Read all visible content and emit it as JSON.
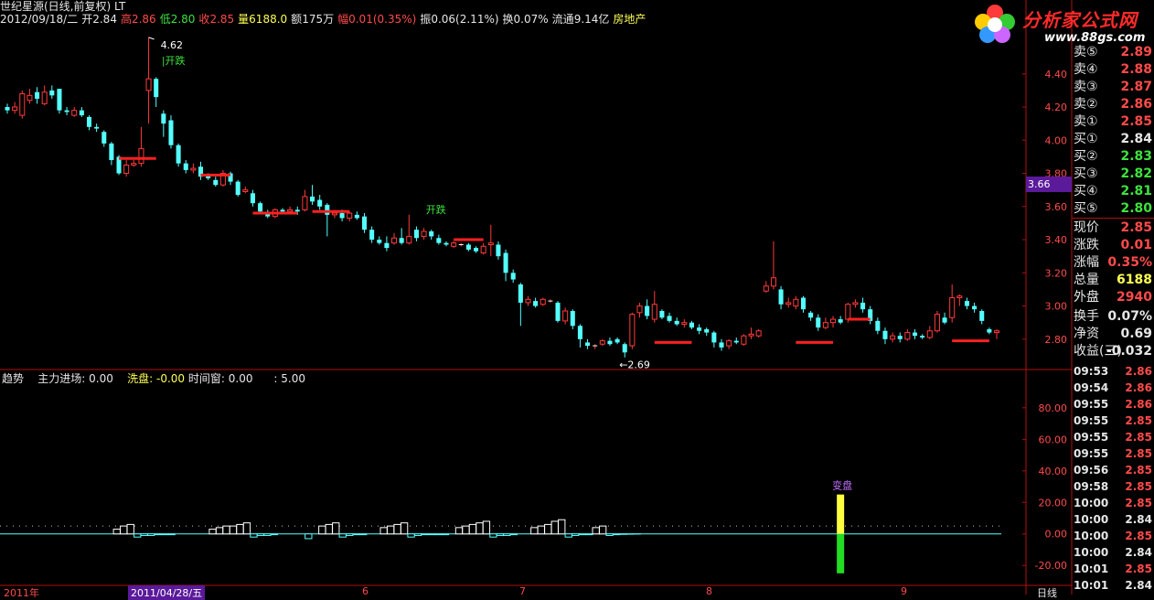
{
  "header": {
    "title": "世纪星源(日线,前复权) LT",
    "date": "2012/09/18/二",
    "open_label": "开",
    "open": "2.84",
    "high_label": "高",
    "high": "2.86",
    "low_label": "低",
    "low": "2.80",
    "close_label": "收",
    "close": "2.85",
    "volume_label": "量",
    "volume": "6188.0",
    "amount_label": "额",
    "amount": "175万",
    "change_label": "幅",
    "change": "0.01(0.35%)",
    "amplitude_label": "振",
    "amplitude": "0.06(2.11%)",
    "turnover_label": "换",
    "turnover": "0.07%",
    "float_label": "流通",
    "float": "9.14亿",
    "sector": "房地产"
  },
  "logo": {
    "text": "分析家公式网",
    "url": "www.88gs.com"
  },
  "price_axis": {
    "ticks": [
      "4.40",
      "4.20",
      "4.00",
      "3.80",
      "3.60",
      "3.40",
      "3.20",
      "3.00",
      "2.80"
    ],
    "cursor_value": "3.66"
  },
  "annotations": {
    "high_marker": "4.62",
    "low_marker": "2.69",
    "label_1": "开跌",
    "label_2": "开跌",
    "bianpan": "变盘"
  },
  "indicator": {
    "name": "趋势",
    "main_label": "主力进场:",
    "main_value": "0.00",
    "wash_label": "洗盘:",
    "wash_value": "-0.00",
    "time_label": "时间窗:",
    "time_value": "0.00",
    "extra_value": ": 5.00",
    "ticks": [
      "80.00",
      "60.00",
      "40.00",
      "20.00",
      "0.00",
      "-20.00"
    ]
  },
  "bottom_axis": {
    "left": "2011年",
    "date_box": "2011/04/28/五",
    "m6": "6",
    "m7": "7",
    "m8": "8",
    "m9": "9",
    "right_label": "日线"
  },
  "order_book": [
    {
      "label": "卖⑤",
      "value": "2.89",
      "color": "#ff4a4a"
    },
    {
      "label": "卖④",
      "value": "2.88",
      "color": "#ff4a4a"
    },
    {
      "label": "卖③",
      "value": "2.87",
      "color": "#ff4a4a"
    },
    {
      "label": "卖②",
      "value": "2.86",
      "color": "#ff4a4a"
    },
    {
      "label": "卖①",
      "value": "2.85",
      "color": "#ff4a4a"
    },
    {
      "label": "买①",
      "value": "2.84",
      "color": "#e6e6e6"
    },
    {
      "label": "买②",
      "value": "2.83",
      "color": "#3ee23e"
    },
    {
      "label": "买③",
      "value": "2.82",
      "color": "#3ee23e"
    },
    {
      "label": "买④",
      "value": "2.81",
      "color": "#3ee23e"
    },
    {
      "label": "买⑤",
      "value": "2.80",
      "color": "#3ee23e"
    }
  ],
  "quote_info": [
    {
      "label": "现价",
      "value": "2.85",
      "color": "#ff4a4a"
    },
    {
      "label": "涨跌",
      "value": "0.01",
      "color": "#ff4a4a"
    },
    {
      "label": "涨幅",
      "value": "0.35%",
      "color": "#ff4a4a"
    },
    {
      "label": "总量",
      "value": "6188",
      "color": "#ffff54"
    },
    {
      "label": "外盘",
      "value": "2940",
      "color": "#ff4a4a"
    },
    {
      "label": "换手",
      "value": "0.07%",
      "color": "#e6e6e6"
    },
    {
      "label": "净资",
      "value": "0.69",
      "color": "#e6e6e6"
    },
    {
      "label": "收益(三)",
      "value": "-0.032",
      "color": "#e6e6e6"
    }
  ],
  "ticks": [
    {
      "time": "09:53",
      "value": "2.86",
      "color": "#ff4a4a"
    },
    {
      "time": "09:54",
      "value": "2.86",
      "color": "#ff4a4a"
    },
    {
      "time": "09:55",
      "value": "2.86",
      "color": "#ff4a4a"
    },
    {
      "time": "09:55",
      "value": "2.85",
      "color": "#ff4a4a"
    },
    {
      "time": "09:55",
      "value": "2.85",
      "color": "#ff4a4a"
    },
    {
      "time": "09:55",
      "value": "2.85",
      "color": "#ff4a4a"
    },
    {
      "time": "09:56",
      "value": "2.85",
      "color": "#ff4a4a"
    },
    {
      "time": "09:58",
      "value": "2.85",
      "color": "#ff4a4a"
    },
    {
      "time": "10:00",
      "value": "2.85",
      "color": "#ff4a4a"
    },
    {
      "time": "10:00",
      "value": "2.84",
      "color": "#e6e6e6"
    },
    {
      "time": "10:00",
      "value": "2.85",
      "color": "#ff4a4a"
    },
    {
      "time": "10:00",
      "value": "2.84",
      "color": "#e6e6e6"
    },
    {
      "time": "10:01",
      "value": "2.85",
      "color": "#ff4a4a"
    },
    {
      "time": "10:01",
      "value": "2.84",
      "color": "#e6e6e6"
    }
  ],
  "chart_data": {
    "type": "candlestick",
    "price_range": [
      2.65,
      4.68
    ],
    "candles": [
      [
        4.2,
        4.18,
        4.22,
        4.16
      ],
      [
        4.18,
        4.2,
        4.23,
        4.16
      ],
      [
        4.15,
        4.28,
        4.3,
        4.13
      ],
      [
        4.24,
        4.27,
        4.31,
        4.22
      ],
      [
        4.29,
        4.25,
        4.32,
        4.22
      ],
      [
        4.22,
        4.29,
        4.33,
        4.21
      ],
      [
        4.3,
        4.27,
        4.33,
        4.25
      ],
      [
        4.31,
        4.18,
        4.31,
        4.16
      ],
      [
        4.18,
        4.17,
        4.2,
        4.15
      ],
      [
        4.15,
        4.18,
        4.2,
        4.14
      ],
      [
        4.18,
        4.15,
        4.2,
        4.14
      ],
      [
        4.14,
        4.08,
        4.15,
        4.06
      ],
      [
        4.08,
        4.07,
        4.1,
        4.05
      ],
      [
        4.05,
        3.98,
        4.06,
        3.96
      ],
      [
        3.98,
        3.88,
        3.99,
        3.85
      ],
      [
        3.9,
        3.8,
        3.91,
        3.79
      ],
      [
        3.8,
        3.85,
        3.88,
        3.78
      ],
      [
        3.85,
        3.86,
        3.88,
        3.84
      ],
      [
        3.86,
        3.95,
        4.08,
        3.84
      ],
      [
        4.3,
        4.37,
        4.62,
        4.1
      ],
      [
        4.37,
        4.26,
        4.38,
        4.2
      ],
      [
        4.16,
        4.1,
        4.18,
        4.02
      ],
      [
        4.12,
        3.97,
        4.15,
        3.95
      ],
      [
        3.97,
        3.86,
        3.98,
        3.84
      ],
      [
        3.86,
        3.82,
        3.88,
        3.8
      ],
      [
        3.82,
        3.83,
        3.86,
        3.8
      ],
      [
        3.84,
        3.78,
        3.87,
        3.76
      ],
      [
        3.79,
        3.77,
        3.8,
        3.76
      ],
      [
        3.76,
        3.73,
        3.78,
        3.72
      ],
      [
        3.73,
        3.8,
        3.82,
        3.72
      ],
      [
        3.8,
        3.75,
        3.81,
        3.73
      ],
      [
        3.75,
        3.67,
        3.76,
        3.66
      ],
      [
        3.69,
        3.7,
        3.72,
        3.68
      ],
      [
        3.68,
        3.62,
        3.7,
        3.6
      ],
      [
        3.62,
        3.57,
        3.63,
        3.56
      ],
      [
        3.56,
        3.54,
        3.58,
        3.53
      ],
      [
        3.54,
        3.58,
        3.59,
        3.53
      ],
      [
        3.58,
        3.57,
        3.59,
        3.56
      ],
      [
        3.57,
        3.58,
        3.6,
        3.56
      ],
      [
        3.58,
        3.57,
        3.6,
        3.55
      ],
      [
        3.58,
        3.66,
        3.7,
        3.57
      ],
      [
        3.66,
        3.63,
        3.73,
        3.61
      ],
      [
        3.64,
        3.6,
        3.67,
        3.58
      ],
      [
        3.61,
        3.55,
        3.62,
        3.42
      ],
      [
        3.55,
        3.56,
        3.58,
        3.53
      ],
      [
        3.56,
        3.53,
        3.58,
        3.51
      ],
      [
        3.53,
        3.56,
        3.57,
        3.51
      ],
      [
        3.55,
        3.53,
        3.57,
        3.52
      ],
      [
        3.54,
        3.46,
        3.56,
        3.44
      ],
      [
        3.46,
        3.4,
        3.48,
        3.38
      ],
      [
        3.4,
        3.38,
        3.42,
        3.37
      ],
      [
        3.38,
        3.35,
        3.42,
        3.33
      ],
      [
        3.38,
        3.41,
        3.44,
        3.37
      ],
      [
        3.41,
        3.38,
        3.47,
        3.37
      ],
      [
        3.38,
        3.42,
        3.55,
        3.37
      ],
      [
        3.46,
        3.41,
        3.48,
        3.39
      ],
      [
        3.42,
        3.45,
        3.47,
        3.4
      ],
      [
        3.45,
        3.42,
        3.46,
        3.4
      ],
      [
        3.41,
        3.38,
        3.43,
        3.37
      ],
      [
        3.38,
        3.37,
        3.39,
        3.36
      ],
      [
        3.36,
        3.38,
        3.39,
        3.35
      ],
      [
        3.37,
        3.37,
        3.38,
        3.36
      ],
      [
        3.37,
        3.34,
        3.38,
        3.33
      ],
      [
        3.35,
        3.33,
        3.36,
        3.32
      ],
      [
        3.32,
        3.36,
        3.38,
        3.31
      ],
      [
        3.37,
        3.38,
        3.49,
        3.3
      ],
      [
        3.37,
        3.3,
        3.39,
        3.28
      ],
      [
        3.32,
        3.2,
        3.34,
        3.15
      ],
      [
        3.2,
        3.16,
        3.22,
        3.14
      ],
      [
        3.13,
        3.02,
        3.14,
        2.88
      ],
      [
        3.02,
        3.04,
        3.06,
        3.0
      ],
      [
        3.03,
        3.0,
        3.05,
        2.99
      ],
      [
        3.01,
        3.04,
        3.05,
        3.0
      ],
      [
        3.03,
        3.03,
        3.04,
        3.02
      ],
      [
        3.02,
        2.91,
        3.03,
        2.9
      ],
      [
        2.91,
        2.97,
        2.99,
        2.89
      ],
      [
        2.97,
        2.88,
        2.98,
        2.86
      ],
      [
        2.88,
        2.8,
        2.89,
        2.75
      ],
      [
        2.78,
        2.76,
        2.8,
        2.74
      ],
      [
        2.76,
        2.76,
        2.77,
        2.74
      ],
      [
        2.77,
        2.79,
        2.8,
        2.76
      ],
      [
        2.79,
        2.77,
        2.81,
        2.76
      ],
      [
        2.8,
        2.78,
        2.81,
        2.77
      ],
      [
        2.77,
        2.72,
        2.78,
        2.69
      ],
      [
        2.76,
        2.95,
        2.96,
        2.74
      ],
      [
        2.96,
        3.0,
        3.02,
        2.93
      ],
      [
        3.0,
        2.94,
        3.04,
        2.92
      ],
      [
        2.92,
        3.01,
        3.09,
        2.9
      ],
      [
        2.97,
        2.93,
        2.98,
        2.92
      ],
      [
        2.94,
        2.91,
        2.96,
        2.9
      ],
      [
        2.91,
        2.89,
        2.93,
        2.88
      ],
      [
        2.89,
        2.9,
        2.92,
        2.87
      ],
      [
        2.9,
        2.87,
        2.91,
        2.86
      ],
      [
        2.87,
        2.85,
        2.89,
        2.83
      ],
      [
        2.86,
        2.84,
        2.87,
        2.82
      ],
      [
        2.84,
        2.78,
        2.85,
        2.75
      ],
      [
        2.78,
        2.75,
        2.8,
        2.73
      ],
      [
        2.76,
        2.79,
        2.8,
        2.74
      ],
      [
        2.79,
        2.78,
        2.81,
        2.77
      ],
      [
        2.77,
        2.82,
        2.83,
        2.76
      ],
      [
        2.82,
        2.83,
        2.87,
        2.8
      ],
      [
        2.82,
        2.85,
        2.86,
        2.81
      ],
      [
        3.09,
        3.12,
        3.15,
        3.08
      ],
      [
        3.12,
        3.17,
        3.39,
        3.1
      ],
      [
        3.1,
        3.01,
        3.12,
        2.98
      ],
      [
        3.01,
        3.02,
        3.05,
        2.99
      ],
      [
        3.0,
        3.04,
        3.06,
        2.98
      ],
      [
        3.05,
        2.98,
        3.06,
        2.96
      ],
      [
        2.96,
        2.93,
        2.97,
        2.91
      ],
      [
        2.93,
        2.87,
        2.95,
        2.85
      ],
      [
        2.87,
        2.9,
        2.93,
        2.86
      ],
      [
        2.9,
        2.92,
        2.94,
        2.87
      ],
      [
        2.92,
        2.9,
        2.94,
        2.89
      ],
      [
        2.92,
        3.01,
        3.02,
        2.9
      ],
      [
        3.01,
        3.02,
        3.04,
        2.99
      ],
      [
        3.02,
        2.98,
        3.05,
        2.96
      ],
      [
        2.98,
        2.91,
        3.0,
        2.89
      ],
      [
        2.91,
        2.85,
        2.93,
        2.83
      ],
      [
        2.85,
        2.8,
        2.87,
        2.77
      ],
      [
        2.8,
        2.82,
        2.84,
        2.78
      ],
      [
        2.82,
        2.8,
        2.84,
        2.78
      ],
      [
        2.8,
        2.84,
        2.86,
        2.79
      ],
      [
        2.84,
        2.82,
        2.86,
        2.8
      ],
      [
        2.82,
        2.81,
        2.83,
        2.8
      ],
      [
        2.81,
        2.85,
        2.88,
        2.8
      ],
      [
        2.85,
        2.95,
        2.97,
        2.84
      ],
      [
        2.93,
        2.9,
        2.96,
        2.89
      ],
      [
        2.93,
        3.05,
        3.13,
        2.9
      ],
      [
        3.05,
        3.06,
        3.07,
        3.0
      ],
      [
        3.03,
        3.0,
        3.05,
        2.98
      ],
      [
        3.0,
        2.98,
        3.02,
        2.96
      ],
      [
        2.97,
        2.91,
        2.98,
        2.89
      ],
      [
        2.86,
        2.84,
        2.87,
        2.83
      ],
      [
        2.84,
        2.85,
        2.86,
        2.8
      ]
    ],
    "indicator_bars": [
      0,
      0,
      0,
      0,
      0,
      0,
      0,
      0,
      0,
      0,
      0,
      0,
      0,
      0,
      0,
      0,
      3,
      5,
      6,
      -2,
      -1,
      -1,
      -0.5,
      -0.5,
      -0.5,
      0,
      0,
      0,
      0,
      0,
      3,
      4,
      5,
      5,
      6,
      7,
      -2,
      -1,
      -1,
      -0.5,
      0,
      0,
      0,
      0,
      -3,
      0,
      5,
      6,
      7,
      -2,
      -1,
      -0.5,
      -0.5,
      0,
      0,
      4,
      5,
      6,
      7,
      -2,
      -1,
      -0.5,
      -0.5,
      -0.5,
      -0.5,
      0,
      4,
      5,
      6,
      7,
      8,
      -2,
      -1,
      -1,
      -0.5,
      0,
      0,
      4,
      5,
      6,
      8,
      9,
      -2,
      -1,
      -0.5,
      -0.5,
      4,
      5,
      -1,
      -0.5,
      -0.3,
      -0.2,
      -0.1,
      0,
      0
    ],
    "bianpan_index": 112,
    "bianpan_up": 25,
    "bianpan_down": -25,
    "indicator_range": [
      -28,
      95
    ]
  }
}
